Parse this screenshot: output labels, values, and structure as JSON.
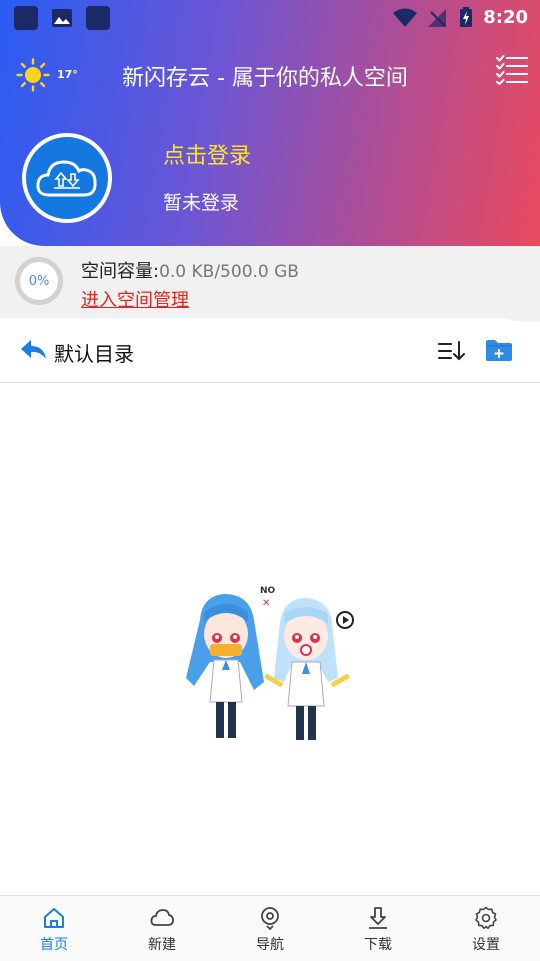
{
  "status_bar": {
    "time": "8:20"
  },
  "header": {
    "weather_temp": "17°",
    "title": "新闪存云 - 属于你的私人空间",
    "login_link": "点击登录",
    "login_status": "暂未登录",
    "colors": {
      "gradient_start": "#2a5cf2",
      "gradient_end": "#e94a5e",
      "login_link": "#ffe32b"
    }
  },
  "storage": {
    "percent_label": "0%",
    "capacity_label": "空间容量:",
    "capacity_value": "0.0 KB/500.0 GB",
    "used_fraction": 0,
    "manage_link": "进入空间管理"
  },
  "directory": {
    "name": "默认目录"
  },
  "empty_state": {
    "no_label": "NO"
  },
  "tabs": [
    {
      "label": "首页",
      "icon": "home-icon",
      "active": true
    },
    {
      "label": "新建",
      "icon": "cloud-icon",
      "active": false
    },
    {
      "label": "导航",
      "icon": "navigation-icon",
      "active": false
    },
    {
      "label": "下载",
      "icon": "download-icon",
      "active": false
    },
    {
      "label": "设置",
      "icon": "settings-icon",
      "active": false
    }
  ]
}
